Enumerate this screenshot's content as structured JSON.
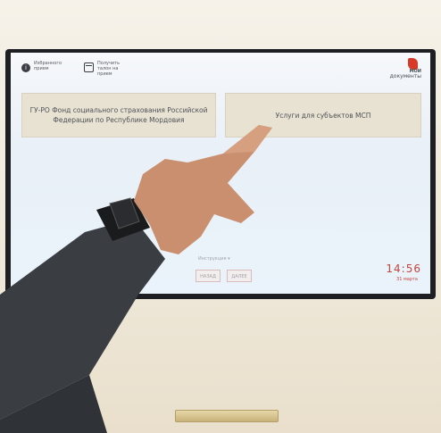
{
  "header": {
    "items": [
      {
        "icon": "info-icon",
        "text": "Избранного\nприем"
      },
      {
        "icon": "calendar-icon",
        "text": "Получить\nталон на\nприем"
      }
    ],
    "logo": {
      "top": "МОИ",
      "text": "документы"
    }
  },
  "tiles": [
    {
      "label": "ГУ-РО Фонд социального страхования Российской Федерации по Республике Мордовия"
    },
    {
      "label": "Услуги для субъектов МСП"
    }
  ],
  "footer": {
    "instruction": "Инструкция ▾",
    "back_label": "НАЗАД",
    "next_label": "ДАЛЕЕ",
    "time": "14:56",
    "date": "31 марта"
  },
  "colors": {
    "accent": "#c4453f",
    "tile_bg": "#e8e2d2",
    "logo_red": "#d83a2a"
  }
}
